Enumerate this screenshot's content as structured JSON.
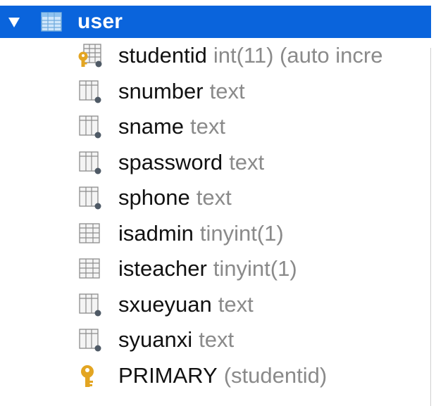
{
  "table": {
    "name": "user",
    "expanded": true,
    "selected_color": "#0a64dc"
  },
  "columns": [
    {
      "name": "studentid",
      "type": "int(11) (auto incre",
      "icon": "primary-key-column-icon"
    },
    {
      "name": "snumber",
      "type": "text",
      "icon": "text-column-icon"
    },
    {
      "name": "sname",
      "type": "text",
      "icon": "text-column-icon"
    },
    {
      "name": "spassword",
      "type": "text",
      "icon": "text-column-icon"
    },
    {
      "name": "sphone",
      "type": "text",
      "icon": "text-column-icon"
    },
    {
      "name": "isadmin",
      "type": "tinyint(1)",
      "icon": "number-column-icon"
    },
    {
      "name": "isteacher",
      "type": "tinyint(1)",
      "icon": "number-column-icon"
    },
    {
      "name": "sxueyuan",
      "type": "text",
      "icon": "text-column-icon"
    },
    {
      "name": "syuanxi",
      "type": "text",
      "icon": "text-column-icon"
    }
  ],
  "index": {
    "name": "PRIMARY",
    "detail": "(studentid)",
    "icon": "key-icon"
  }
}
